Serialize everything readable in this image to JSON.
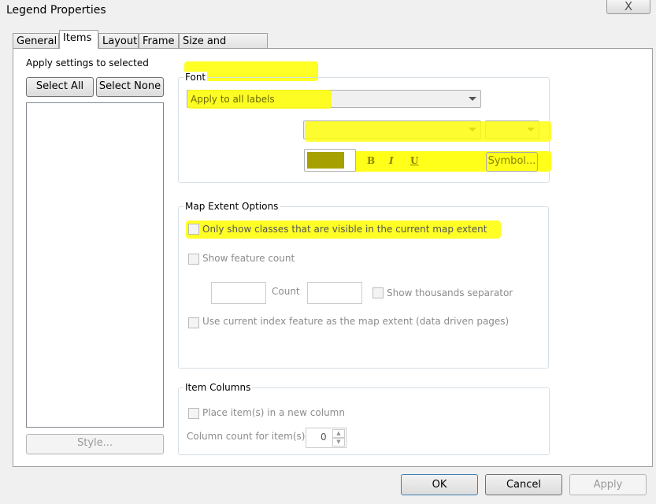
{
  "window": {
    "title": "Legend Properties",
    "close_label": "X"
  },
  "tabs": [
    {
      "label": "General"
    },
    {
      "label": "Items"
    },
    {
      "label": "Layout"
    },
    {
      "label": "Frame"
    },
    {
      "label": "Size and Position"
    }
  ],
  "left": {
    "apply_label": "Apply settings to selected",
    "select_all": "Select All",
    "select_none": "Select None",
    "style": "Style..."
  },
  "font": {
    "label": "Font",
    "apply_to": "Apply to all labels",
    "color": "#a6a000",
    "bold": "B",
    "italic": "I",
    "underline": "U",
    "symbol": "Symbol..."
  },
  "extent": {
    "label": "Map Extent Options",
    "only_visible": "Only show classes that are visible in the current map extent",
    "feature_count": "Show feature count",
    "count": "Count",
    "thousands": "Show thousands separator",
    "index": "Use current index feature as the map extent (data driven pages)"
  },
  "columns": {
    "label": "Item Columns",
    "new_column": "Place item(s) in a new column",
    "count_label": "Column count for item(s)",
    "count_value": "0"
  },
  "footer": {
    "ok": "OK",
    "cancel": "Cancel",
    "apply": "Apply"
  },
  "highlight_color": "#ffff00"
}
